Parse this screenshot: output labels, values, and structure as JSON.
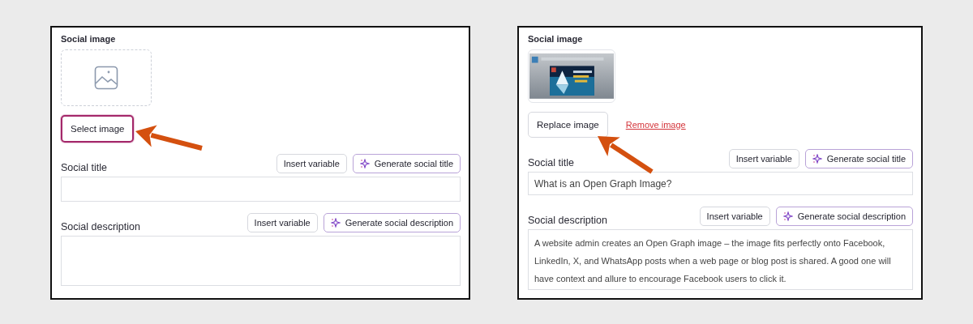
{
  "panels": [
    {
      "social_image": {
        "label": "Social image",
        "preview": {
          "kind": "empty"
        },
        "button": "Select image",
        "button_focused": true
      },
      "fields": [
        {
          "label": "Social title",
          "insert": "Insert variable",
          "generate": "Generate social title",
          "kind": "line"
        },
        {
          "label": "Social description",
          "insert": "Insert variable",
          "generate": "Generate social description",
          "kind": "area"
        }
      ]
    },
    {
      "social_image": {
        "label": "Social image",
        "button": "Replace image",
        "button_focused": false,
        "remove_link": "Remove image"
      },
      "fields": [
        {
          "label": "Social title",
          "insert": "Insert variable",
          "generate": "Generate social title",
          "kind": "line",
          "value": "What is an Open Graph Image?"
        },
        {
          "label": "Social description",
          "insert": "Insert variable",
          "generate": "Generate social description",
          "kind": "area",
          "value": "A website admin creates an Open Graph image – the image fits perfectly onto Facebook, LinkedIn, X, and WhatsApp posts when a web page or blog post is shared. A good one will have context and allure to encourage Facebook users to click it."
        }
      ]
    }
  ]
}
